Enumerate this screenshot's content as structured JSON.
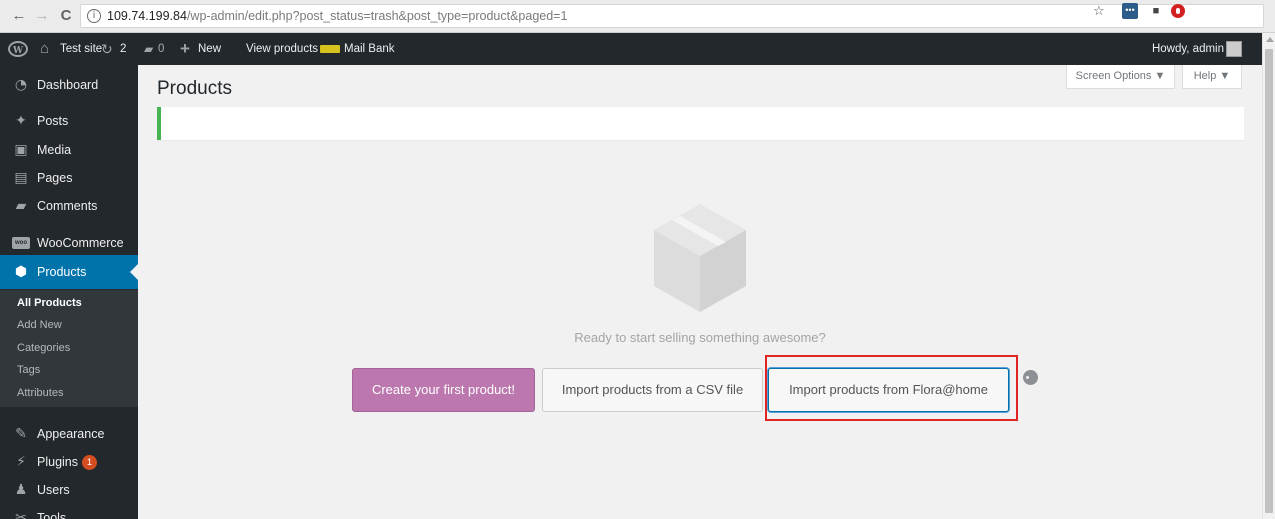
{
  "browser": {
    "url_host": "109.74.199.84",
    "url_path": "/wp-admin/edit.php?post_status=trash&post_type=product&paged=1"
  },
  "adminbar": {
    "site_name": "Test site",
    "updates_count": "2",
    "comments_count": "0",
    "new_label": "New",
    "view_products_label": "View products",
    "mail_bank_label": "Mail Bank",
    "howdy": "Howdy, admin"
  },
  "sidebar": {
    "dashboard": "Dashboard",
    "posts": "Posts",
    "media": "Media",
    "pages": "Pages",
    "comments": "Comments",
    "woocommerce": "WooCommerce",
    "products": "Products",
    "submenu": {
      "all_products": "All Products",
      "add_new": "Add New",
      "categories": "Categories",
      "tags": "Tags",
      "attributes": "Attributes"
    },
    "appearance": "Appearance",
    "plugins": "Plugins",
    "plugins_badge": "1",
    "users": "Users",
    "tools": "Tools"
  },
  "screen_options_label": "Screen Options ▼",
  "help_label": "Help ▼",
  "page_title": "Products",
  "empty_state": {
    "message": "Ready to start selling something awesome?",
    "create_button": "Create your first product!",
    "import_csv_button": "Import products from a CSV file",
    "import_flora_button": "Import products from Flora@home"
  },
  "colors": {
    "admin_dark": "#23282d",
    "active_blue": "#0073aa",
    "woo_purple": "#bb77ae",
    "highlight_red": "#e02424",
    "notice_green": "#46b450"
  }
}
